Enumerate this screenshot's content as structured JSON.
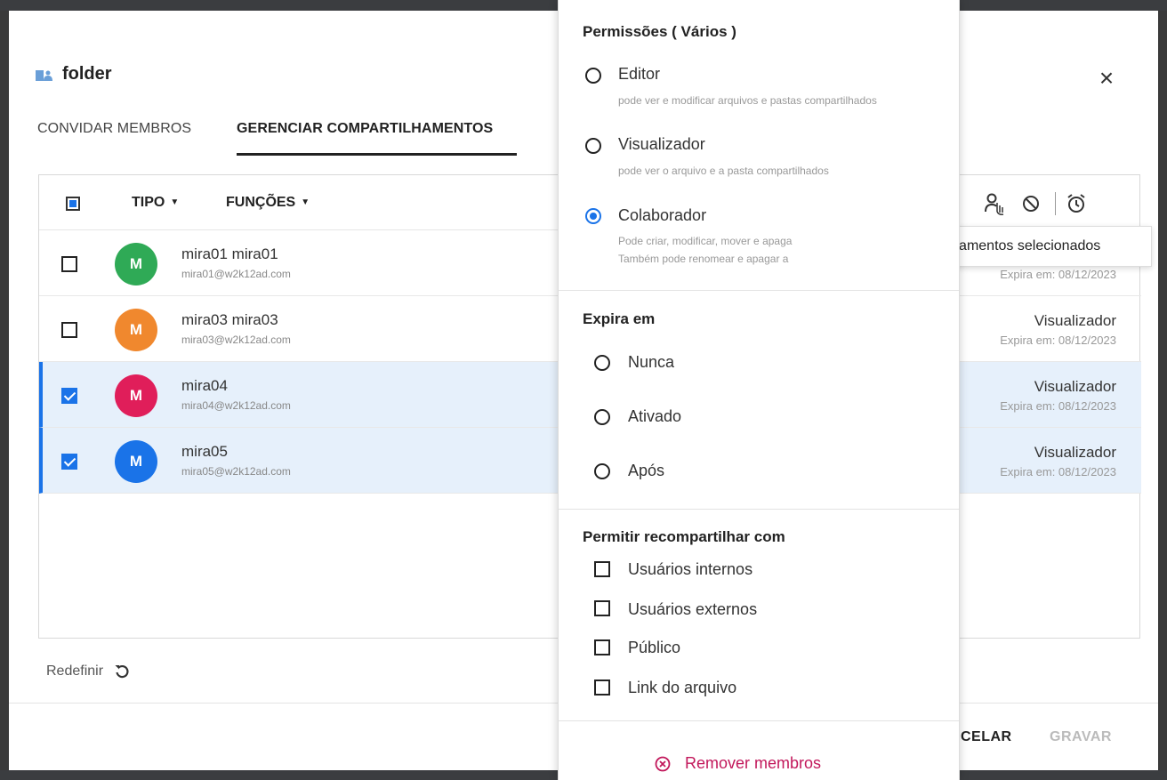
{
  "dialog": {
    "title": "folder",
    "tabs": {
      "invite": "CONVIDAR MEMBROS",
      "manage": "GERENCIAR COMPARTILHAMENTOS"
    },
    "header": {
      "tipo": "TIPO",
      "funcoes": "FUNÇÕES"
    },
    "rows": [
      {
        "initial": "M",
        "color": "#2faa56",
        "name": "mira01 mira01",
        "email": "mira01@w2k12ad.com",
        "role": "",
        "expires": "Expira em: 08/12/2023",
        "selected": false
      },
      {
        "initial": "M",
        "color": "#f0882e",
        "name": "mira03 mira03",
        "email": "mira03@w2k12ad.com",
        "role": "Visualizador",
        "expires": "Expira em: 08/12/2023",
        "selected": false
      },
      {
        "initial": "M",
        "color": "#e01e5a",
        "name": "mira04",
        "email": "mira04@w2k12ad.com",
        "role": "Visualizador",
        "expires": "Expira em: 08/12/2023",
        "selected": true
      },
      {
        "initial": "M",
        "color": "#1a73e8",
        "name": "mira05",
        "email": "mira05@w2k12ad.com",
        "role": "Visualizador",
        "expires": "Expira em: 08/12/2023",
        "selected": true
      }
    ],
    "tooltip": "Editar compartilhamentos selecionados",
    "reset_label": "Redefinir",
    "cancel_label": "CELAR",
    "save_label": "GRAVAR"
  },
  "panel": {
    "permissions_title": "Permissões ( Vários )",
    "options": [
      {
        "label": "Editor",
        "desc": "pode ver e modificar arquivos e pastas compartilhados",
        "checked": false
      },
      {
        "label": "Visualizador",
        "desc": "pode ver o arquivo e a pasta compartilhados",
        "checked": false
      },
      {
        "label": "Colaborador",
        "desc": "Pode criar, modificar, mover e apaga",
        "desc2": "Também pode renomear e apagar a",
        "checked": true
      }
    ],
    "expires_title": "Expira em",
    "expires_options": [
      "Nunca",
      "Ativado",
      "Após"
    ],
    "reshare_title": "Permitir recompartilhar com",
    "reshare_options": [
      "Usuários internos",
      "Usuários externos",
      "Público",
      "Link do arquivo"
    ],
    "remove_label": "Remover membros"
  },
  "colors": {
    "accent": "#1a73e8",
    "danger": "#c2185b",
    "selected_row": "#e6f0fb"
  }
}
